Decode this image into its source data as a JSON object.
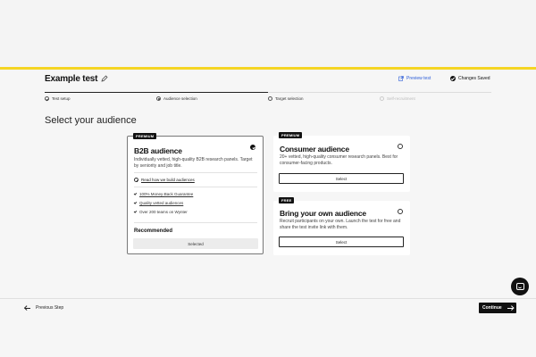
{
  "header": {
    "title": "Example test",
    "preview_label": "Preview test",
    "saved_label": "Changes Saved"
  },
  "stepper": {
    "steps": [
      {
        "label": "Test setup",
        "state": "done"
      },
      {
        "label": "Audience selection",
        "state": "current"
      },
      {
        "label": "Target selection",
        "state": "upcoming"
      },
      {
        "label": "Self-recruitment",
        "state": "disabled"
      }
    ]
  },
  "main": {
    "heading": "Select your audience",
    "cards": {
      "b2b": {
        "badge": "PREMIUM",
        "title": "B2B audience",
        "description": "Individually vetted, high-quality B2B research panels. Target by seniority and job title.",
        "learn_link": "Read how we build audiences",
        "features": [
          "100% Money-Back Guarantee",
          "Quality vetted audiences",
          "Over 200 teams on Wynter"
        ],
        "recommended": "Recommended",
        "button": "Selected",
        "selected": true
      },
      "consumer": {
        "badge": "PREMIUM",
        "title": "Consumer audience",
        "description": "20+ vetted, high-quality consumer research panels. Best for consumer-facing products.",
        "button": "Select",
        "selected": false
      },
      "byo": {
        "badge": "FREE",
        "title": "Bring your own audience",
        "description": "Recruit participants on your own. Launch the test for free and share the test invite link with them.",
        "button": "Select",
        "selected": false
      }
    }
  },
  "footer": {
    "previous_label": "Previous Step",
    "continue_label": "Continue"
  },
  "colors": {
    "accent": "#f5d523",
    "link": "#2a5bd7",
    "primary": "#111111"
  }
}
